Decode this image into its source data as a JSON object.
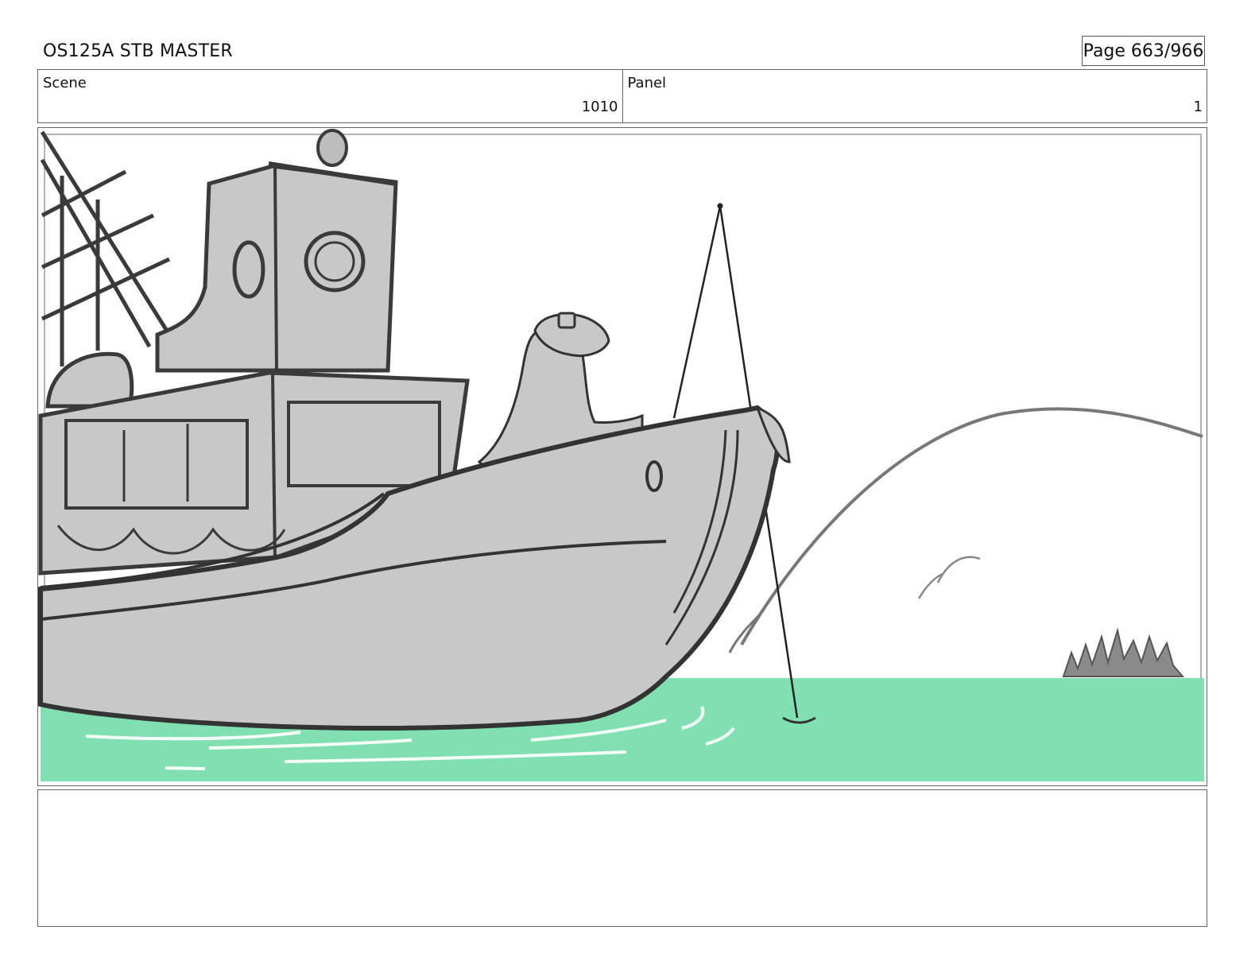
{
  "header": {
    "title": "OS125A STB MASTER",
    "page": "Page 663/966"
  },
  "info": {
    "scene_label": "Scene",
    "scene_value": "1010",
    "panel_label": "Panel",
    "panel_value": "1"
  },
  "panel_image": {
    "description_icon": "storyboard-sketch-fishing-boat",
    "colors": {
      "water": "#80e0b1",
      "boat_fill": "#c8c8c8",
      "line": "#3a3a3a",
      "hill_line": "#777777"
    }
  },
  "notes": {
    "text": ""
  }
}
